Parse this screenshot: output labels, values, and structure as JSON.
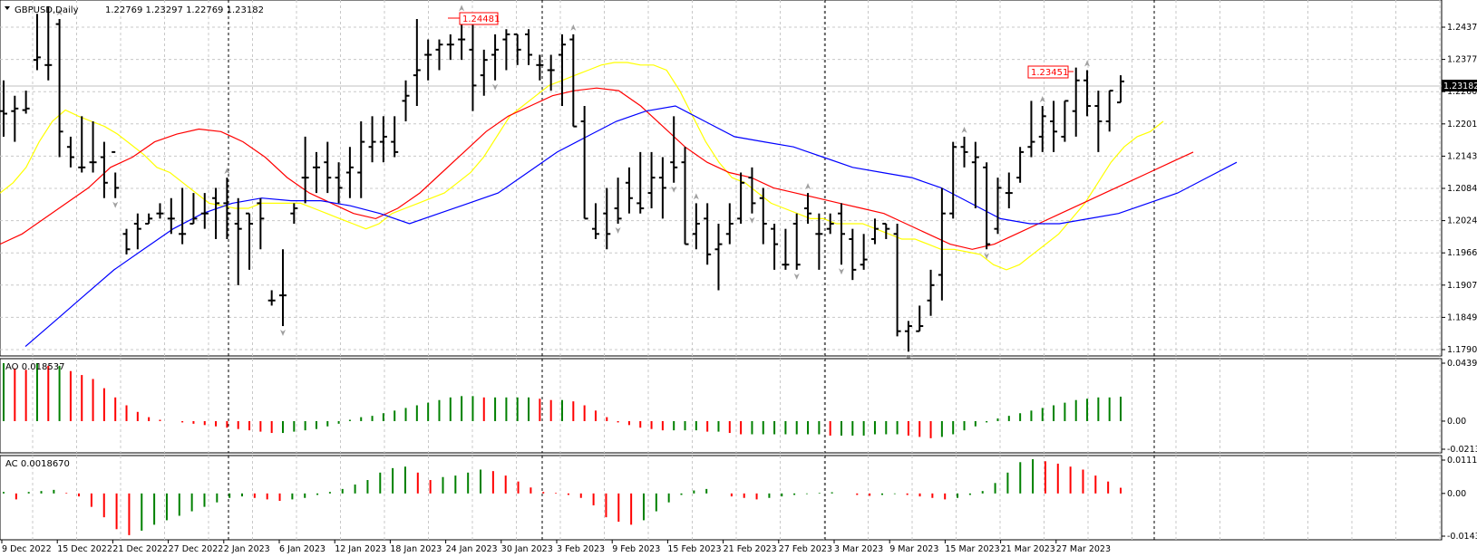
{
  "main_panel": {
    "symbol_label": "GBPUSD,Daily",
    "ohlc": "1.22769 1.23297 1.22769 1.23182",
    "price_ticks": [
      "1.24370",
      "1.23770",
      "1.22600",
      "1.22015",
      "1.21430",
      "1.20845",
      "1.20245",
      "1.19660",
      "1.19075",
      "1.18490",
      "1.17905"
    ],
    "current_price": "1.23182",
    "high_marker": "1.24481",
    "second_high_marker": "1.23451"
  },
  "ao_panel": {
    "label": "AO 0.018537",
    "ticks": [
      "0.043994",
      "0.00",
      "-0.021347"
    ]
  },
  "ac_panel": {
    "label": "AC 0.0018670",
    "ticks": [
      "0.0111949",
      "0.00",
      "-0.014346"
    ]
  },
  "time_axis": [
    "9 Dec 2022",
    "15 Dec 2022",
    "21 Dec 2022",
    "27 Dec 2022",
    "2 Jan 2023",
    "6 Jan 2023",
    "12 Jan 2023",
    "18 Jan 2023",
    "24 Jan 2023",
    "30 Jan 2023",
    "3 Feb 2023",
    "9 Feb 2023",
    "15 Feb 2023",
    "21 Feb 2023",
    "27 Feb 2023",
    "3 Mar 2023",
    "9 Mar 2023",
    "15 Mar 2023",
    "21 Mar 2023",
    "27 Mar 2023"
  ],
  "colors": {
    "yellow_ma": "#ffff00",
    "red_ma": "#ff0000",
    "blue_ma": "#0000ff",
    "up_bar": "#008000",
    "down_bar": "#ff0000",
    "price_bar": "#000000"
  },
  "chart_data": {
    "type": "ohlc",
    "ohlc": [
      {
        "o": 1.226,
        "h": 1.232,
        "l": 1.221,
        "c": 1.2255
      },
      {
        "o": 1.226,
        "h": 1.229,
        "l": 1.22,
        "c": 1.2265
      },
      {
        "o": 1.2262,
        "h": 1.23,
        "l": 1.2255,
        "c": 1.2265
      },
      {
        "o": 1.236,
        "h": 1.245,
        "l": 1.234,
        "c": 1.2365
      },
      {
        "o": 1.235,
        "h": 1.2465,
        "l": 1.232,
        "c": 1.235
      },
      {
        "o": 1.243,
        "h": 1.244,
        "l": 1.217,
        "c": 1.222
      },
      {
        "o": 1.219,
        "h": 1.221,
        "l": 1.215,
        "c": 1.217
      },
      {
        "o": 1.215,
        "h": 1.225,
        "l": 1.214,
        "c": 1.215
      },
      {
        "o": 1.216,
        "h": 1.224,
        "l": 1.214,
        "c": 1.216
      },
      {
        "o": 1.217,
        "h": 1.22,
        "l": 1.209,
        "c": 1.212
      },
      {
        "o": 1.218,
        "h": 1.214,
        "l": 1.209,
        "c": 1.211
      },
      {
        "o": 1.202,
        "h": 1.203,
        "l": 1.198,
        "c": 1.199
      },
      {
        "o": 1.204,
        "h": 1.206,
        "l": 1.199,
        "c": 1.203
      },
      {
        "o": 1.204,
        "h": 1.206,
        "l": 1.204,
        "c": 1.205
      },
      {
        "o": 1.206,
        "h": 1.208,
        "l": 1.205,
        "c": 1.206
      },
      {
        "o": 1.205,
        "h": 1.209,
        "l": 1.202,
        "c": 1.205
      },
      {
        "o": 1.202,
        "h": 1.211,
        "l": 1.2,
        "c": 1.202
      },
      {
        "o": 1.204,
        "h": 1.21,
        "l": 1.204,
        "c": 1.205
      },
      {
        "o": 1.206,
        "h": 1.21,
        "l": 1.203,
        "c": 1.206
      },
      {
        "o": 1.209,
        "h": 1.211,
        "l": 1.201,
        "c": 1.208
      },
      {
        "o": 1.208,
        "h": 1.213,
        "l": 1.201,
        "c": 1.206
      },
      {
        "o": 1.204,
        "h": 1.209,
        "l": 1.192,
        "c": 1.203
      },
      {
        "o": 1.206,
        "h": 1.206,
        "l": 1.195,
        "c": 1.204
      },
      {
        "o": 1.208,
        "h": 1.209,
        "l": 1.199,
        "c": 1.205
      },
      {
        "o": 1.189,
        "h": 1.191,
        "l": 1.188,
        "c": 1.189
      },
      {
        "o": 1.19,
        "h": 1.199,
        "l": 1.184,
        "c": 1.19
      },
      {
        "o": 1.206,
        "h": 1.208,
        "l": 1.204,
        "c": 1.207
      },
      {
        "o": 1.213,
        "h": 1.221,
        "l": 1.208,
        "c": 1.213
      },
      {
        "o": 1.215,
        "h": 1.218,
        "l": 1.21,
        "c": 1.215
      },
      {
        "o": 1.216,
        "h": 1.22,
        "l": 1.21,
        "c": 1.213
      },
      {
        "o": 1.213,
        "h": 1.216,
        "l": 1.208,
        "c": 1.211
      },
      {
        "o": 1.214,
        "h": 1.219,
        "l": 1.209,
        "c": 1.215
      },
      {
        "o": 1.214,
        "h": 1.224,
        "l": 1.209,
        "c": 1.22
      },
      {
        "o": 1.219,
        "h": 1.225,
        "l": 1.216,
        "c": 1.22
      },
      {
        "o": 1.22,
        "h": 1.225,
        "l": 1.216,
        "c": 1.221
      },
      {
        "o": 1.22,
        "h": 1.225,
        "l": 1.217,
        "c": 1.218
      },
      {
        "o": 1.228,
        "h": 1.232,
        "l": 1.224,
        "c": 1.229
      },
      {
        "o": 1.233,
        "h": 1.244,
        "l": 1.227,
        "c": 1.234
      },
      {
        "o": 1.237,
        "h": 1.24,
        "l": 1.232,
        "c": 1.237
      },
      {
        "o": 1.238,
        "h": 1.24,
        "l": 1.234,
        "c": 1.239
      },
      {
        "o": 1.239,
        "h": 1.241,
        "l": 1.236,
        "c": 1.239
      },
      {
        "o": 1.24,
        "h": 1.2448,
        "l": 1.236,
        "c": 1.24
      },
      {
        "o": 1.238,
        "h": 1.243,
        "l": 1.226,
        "c": 1.231
      },
      {
        "o": 1.233,
        "h": 1.238,
        "l": 1.229,
        "c": 1.236
      },
      {
        "o": 1.237,
        "h": 1.241,
        "l": 1.232,
        "c": 1.238
      },
      {
        "o": 1.24,
        "h": 1.242,
        "l": 1.234,
        "c": 1.241
      },
      {
        "o": 1.241,
        "h": 1.241,
        "l": 1.235,
        "c": 1.238
      },
      {
        "o": 1.241,
        "h": 1.242,
        "l": 1.235,
        "c": 1.237
      },
      {
        "o": 1.235,
        "h": 1.237,
        "l": 1.232,
        "c": 1.235
      },
      {
        "o": 1.234,
        "h": 1.237,
        "l": 1.23,
        "c": 1.234
      },
      {
        "o": 1.237,
        "h": 1.241,
        "l": 1.227,
        "c": 1.239
      },
      {
        "o": 1.24,
        "h": 1.241,
        "l": 1.223,
        "c": 1.223
      },
      {
        "o": 1.224,
        "h": 1.227,
        "l": 1.205,
        "c": 1.205
      },
      {
        "o": 1.203,
        "h": 1.208,
        "l": 1.201,
        "c": 1.202
      },
      {
        "o": 1.206,
        "h": 1.211,
        "l": 1.199,
        "c": 1.202
      },
      {
        "o": 1.207,
        "h": 1.213,
        "l": 1.204,
        "c": 1.205
      },
      {
        "o": 1.212,
        "h": 1.215,
        "l": 1.206,
        "c": 1.209
      },
      {
        "o": 1.208,
        "h": 1.218,
        "l": 1.206,
        "c": 1.207
      },
      {
        "o": 1.21,
        "h": 1.218,
        "l": 1.207,
        "c": 1.213
      },
      {
        "o": 1.213,
        "h": 1.217,
        "l": 1.205,
        "c": 1.211
      },
      {
        "o": 1.216,
        "h": 1.225,
        "l": 1.212,
        "c": 1.215
      },
      {
        "o": 1.216,
        "h": 1.219,
        "l": 1.2,
        "c": 1.2
      },
      {
        "o": 1.202,
        "h": 1.208,
        "l": 1.199,
        "c": 1.204
      },
      {
        "o": 1.205,
        "h": 1.208,
        "l": 1.196,
        "c": 1.198
      },
      {
        "o": 1.199,
        "h": 1.204,
        "l": 1.191,
        "c": 1.2
      },
      {
        "o": 1.202,
        "h": 1.208,
        "l": 1.2,
        "c": 1.204
      },
      {
        "o": 1.205,
        "h": 1.214,
        "l": 1.204,
        "c": 1.212
      },
      {
        "o": 1.213,
        "h": 1.215,
        "l": 1.206,
        "c": 1.208
      },
      {
        "o": 1.209,
        "h": 1.211,
        "l": 1.2,
        "c": 1.204
      },
      {
        "o": 1.203,
        "h": 1.204,
        "l": 1.195,
        "c": 1.2
      },
      {
        "o": 1.196,
        "h": 1.203,
        "l": 1.195,
        "c": 1.196
      },
      {
        "o": 1.204,
        "h": 1.206,
        "l": 1.195,
        "c": 1.196
      },
      {
        "o": 1.207,
        "h": 1.21,
        "l": 1.204,
        "c": 1.206
      },
      {
        "o": 1.202,
        "h": 1.206,
        "l": 1.195,
        "c": 1.202
      },
      {
        "o": 1.203,
        "h": 1.206,
        "l": 1.202,
        "c": 1.204
      },
      {
        "o": 1.206,
        "h": 1.208,
        "l": 1.196,
        "c": 1.202
      },
      {
        "o": 1.201,
        "h": 1.203,
        "l": 1.193,
        "c": 1.195
      },
      {
        "o": 1.196,
        "h": 1.202,
        "l": 1.195,
        "c": 1.197
      },
      {
        "o": 1.201,
        "h": 1.205,
        "l": 1.2,
        "c": 1.203
      },
      {
        "o": 1.204,
        "h": 1.204,
        "l": 1.201,
        "c": 1.203
      },
      {
        "o": 1.202,
        "h": 1.204,
        "l": 1.182,
        "c": 1.183
      },
      {
        "o": 1.183,
        "h": 1.185,
        "l": 1.179,
        "c": 1.184
      },
      {
        "o": 1.183,
        "h": 1.188,
        "l": 1.183,
        "c": 1.184
      },
      {
        "o": 1.189,
        "h": 1.195,
        "l": 1.186,
        "c": 1.192
      },
      {
        "o": 1.194,
        "h": 1.211,
        "l": 1.189,
        "c": 1.206
      },
      {
        "o": 1.206,
        "h": 1.22,
        "l": 1.205,
        "c": 1.219
      },
      {
        "o": 1.219,
        "h": 1.221,
        "l": 1.215,
        "c": 1.218
      },
      {
        "o": 1.216,
        "h": 1.22,
        "l": 1.207,
        "c": 1.217
      },
      {
        "o": 1.215,
        "h": 1.216,
        "l": 1.199,
        "c": 1.2
      },
      {
        "o": 1.203,
        "h": 1.213,
        "l": 1.202,
        "c": 1.211
      },
      {
        "o": 1.21,
        "h": 1.214,
        "l": 1.207,
        "c": 1.21
      },
      {
        "o": 1.213,
        "h": 1.219,
        "l": 1.212,
        "c": 1.218
      },
      {
        "o": 1.219,
        "h": 1.228,
        "l": 1.217,
        "c": 1.22
      },
      {
        "o": 1.221,
        "h": 1.227,
        "l": 1.218,
        "c": 1.225
      },
      {
        "o": 1.224,
        "h": 1.228,
        "l": 1.218,
        "c": 1.222
      },
      {
        "o": 1.221,
        "h": 1.228,
        "l": 1.22,
        "c": 1.228
      },
      {
        "o": 1.226,
        "h": 1.2345,
        "l": 1.221,
        "c": 1.232
      },
      {
        "o": 1.232,
        "h": 1.234,
        "l": 1.225,
        "c": 1.227
      },
      {
        "o": 1.227,
        "h": 1.23,
        "l": 1.218,
        "c": 1.224
      },
      {
        "o": 1.224,
        "h": 1.23,
        "l": 1.222,
        "c": 1.23
      },
      {
        "o": 1.2277,
        "h": 1.233,
        "l": 1.2277,
        "c": 1.2318
      }
    ],
    "yellow_ma": [
      1.21,
      1.212,
      1.215,
      1.22,
      1.224,
      1.2262,
      1.225,
      1.224,
      1.223,
      1.2215,
      1.2195,
      1.2175,
      1.215,
      1.214,
      1.212,
      1.21,
      1.208,
      1.2075,
      1.207,
      1.207,
      1.208,
      1.208,
      1.208,
      1.208,
      1.207,
      1.206,
      1.205,
      1.204,
      1.203,
      1.204,
      1.206,
      1.207,
      1.208,
      1.209,
      1.21,
      1.212,
      1.214,
      1.217,
      1.221,
      1.225,
      1.227,
      1.229,
      1.231,
      1.232,
      1.233,
      1.234,
      1.235,
      1.2355,
      1.2355,
      1.235,
      1.235,
      1.234,
      1.23,
      1.225,
      1.22,
      1.216,
      1.213,
      1.212,
      1.21,
      1.208,
      1.207,
      1.206,
      1.205,
      1.205,
      1.204,
      1.204,
      1.204,
      1.203,
      1.202,
      1.201,
      1.201,
      1.2,
      1.199,
      1.199,
      1.1985,
      1.198,
      1.196,
      1.195,
      1.196,
      1.198,
      1.2,
      1.202,
      1.205,
      1.208,
      1.212,
      1.216,
      1.219,
      1.221,
      1.222,
      1.224
    ],
    "red_ma": [
      1.2,
      1.202,
      1.205,
      1.208,
      1.211,
      1.215,
      1.217,
      1.22,
      1.2215,
      1.2225,
      1.222,
      1.22,
      1.217,
      1.213,
      1.21,
      1.208,
      1.206,
      1.205,
      1.207,
      1.21,
      1.214,
      1.218,
      1.222,
      1.225,
      1.227,
      1.229,
      1.23,
      1.2305,
      1.23,
      1.227,
      1.223,
      1.219,
      1.216,
      1.214,
      1.213,
      1.211,
      1.21,
      1.209,
      1.208,
      1.207,
      1.206,
      1.204,
      1.202,
      1.2,
      1.199,
      1.2,
      1.202,
      1.204,
      1.206,
      1.208,
      1.21,
      1.212,
      1.214,
      1.216,
      1.218
    ],
    "blue_ma": [
      1.18,
      1.185,
      1.19,
      1.195,
      1.199,
      1.203,
      1.206,
      1.208,
      1.209,
      1.2085,
      1.2085,
      1.2075,
      1.206,
      1.204,
      1.206,
      1.208,
      1.21,
      1.214,
      1.218,
      1.221,
      1.224,
      1.226,
      1.227,
      1.224,
      1.221,
      1.22,
      1.219,
      1.217,
      1.215,
      1.214,
      1.213,
      1.211,
      1.208,
      1.205,
      1.204,
      1.204,
      1.205,
      1.206,
      1.208,
      1.21,
      1.213,
      1.216
    ],
    "ao": [
      0.044,
      0.04,
      0.039,
      0.044,
      0.042,
      0.042,
      0.038,
      0.035,
      0.032,
      0.025,
      0.018,
      0.012,
      0.007,
      0.003,
      0.001,
      0.0,
      -0.001,
      -0.002,
      -0.003,
      -0.004,
      -0.005,
      -0.006,
      -0.007,
      -0.008,
      -0.009,
      -0.009,
      -0.008,
      -0.007,
      -0.006,
      -0.004,
      -0.002,
      0.001,
      0.003,
      0.004,
      0.006,
      0.008,
      0.01,
      0.012,
      0.014,
      0.016,
      0.018,
      0.019,
      0.019,
      0.018,
      0.018,
      0.018,
      0.018,
      0.018,
      0.017,
      0.016,
      0.016,
      0.015,
      0.012,
      0.008,
      0.003,
      -0.001,
      -0.003,
      -0.005,
      -0.006,
      -0.007,
      -0.007,
      -0.007,
      -0.007,
      -0.008,
      -0.008,
      -0.009,
      -0.01,
      -0.01,
      -0.01,
      -0.01,
      -0.01,
      -0.01,
      -0.01,
      -0.01,
      -0.011,
      -0.011,
      -0.011,
      -0.011,
      -0.01,
      -0.01,
      -0.01,
      -0.011,
      -0.012,
      -0.013,
      -0.012,
      -0.01,
      -0.007,
      -0.004,
      -0.001,
      0.002,
      0.004,
      0.006,
      0.008,
      0.01,
      0.012,
      0.014,
      0.016,
      0.017,
      0.018,
      0.018,
      0.018537
    ],
    "ac": [
      0.0005,
      -0.002,
      0.0005,
      0.0008,
      0.0012,
      0.0002,
      -0.001,
      -0.0045,
      -0.008,
      -0.012,
      -0.014,
      -0.0125,
      -0.0105,
      -0.009,
      -0.0075,
      -0.006,
      -0.0045,
      -0.003,
      -0.0015,
      -0.001,
      -0.0015,
      -0.002,
      -0.0025,
      -0.002,
      -0.0015,
      -0.0005,
      0.0005,
      0.0015,
      0.003,
      0.0045,
      0.007,
      0.0085,
      0.009,
      0.007,
      0.0045,
      0.0055,
      0.006,
      0.007,
      0.008,
      0.0075,
      0.006,
      0.004,
      0.002,
      0.0005,
      0.0002,
      -0.0005,
      -0.0015,
      -0.004,
      -0.008,
      -0.0095,
      -0.0105,
      -0.009,
      -0.006,
      -0.003,
      -0.0005,
      0.001,
      0.0015,
      0.0,
      -0.001,
      -0.0015,
      -0.002,
      -0.0015,
      -0.001,
      -0.0005,
      -0.0002,
      0.0002,
      0.0004,
      0.0,
      -0.0005,
      -0.0008,
      -0.0005,
      -0.0002,
      -0.0005,
      -0.001,
      -0.0015,
      -0.002,
      -0.0015,
      -0.0005,
      0.0008,
      0.0035,
      0.007,
      0.0105,
      0.0115,
      0.0108,
      0.01,
      0.009,
      0.008,
      0.006,
      0.004,
      0.0019
    ],
    "ylim_price": [
      1.17905,
      1.247
    ],
    "ylim_ao": [
      -0.021347,
      0.043994
    ],
    "ylim_ac": [
      -0.014346,
      0.0111949
    ]
  }
}
